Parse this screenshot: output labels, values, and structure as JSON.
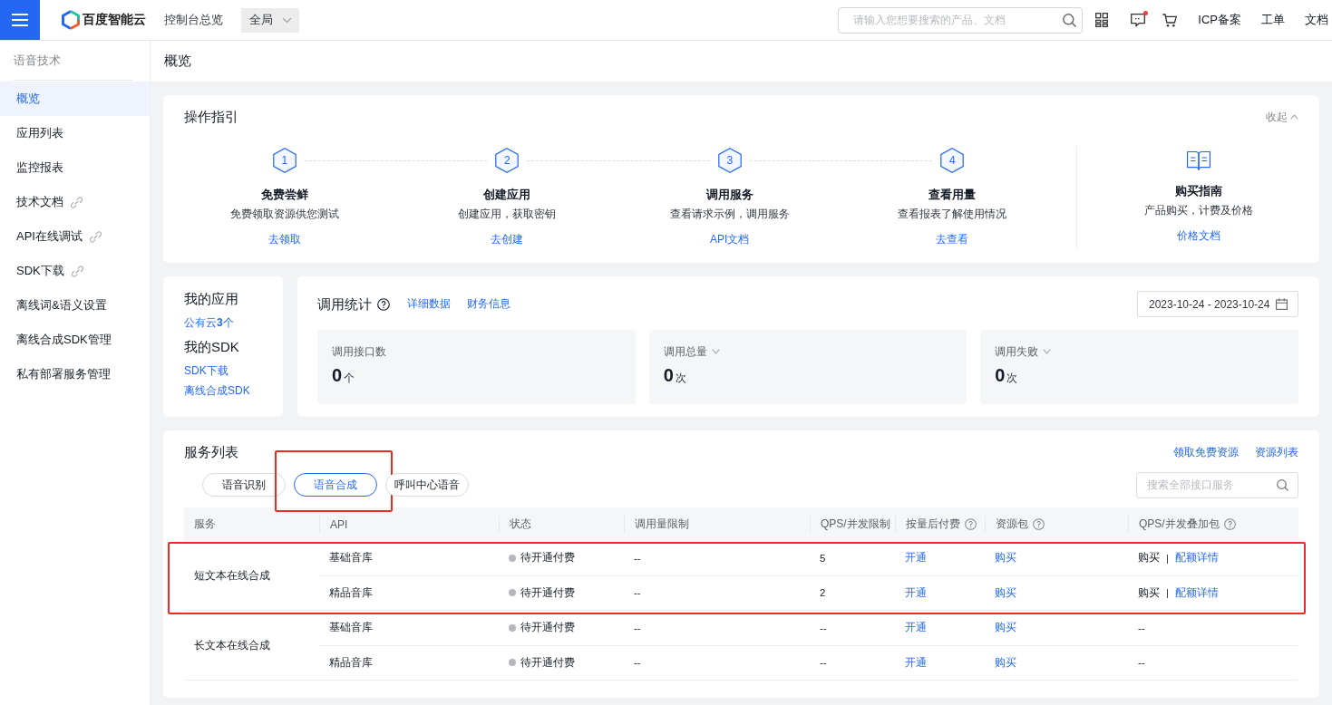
{
  "topbar": {
    "brand": "百度智能云",
    "console": "控制台总览",
    "region": "全局",
    "search": {
      "placeholder": "请输入您想要搜索的产品、文档"
    },
    "message_unread": true,
    "links": [
      "ICP备案",
      "工单",
      "文档"
    ]
  },
  "sidebar": {
    "title": "语音技术",
    "items": [
      {
        "label": "概览",
        "selected": true,
        "external": false
      },
      {
        "label": "应用列表",
        "selected": false,
        "external": false
      },
      {
        "label": "监控报表",
        "selected": false,
        "external": false
      },
      {
        "label": "技术文档",
        "selected": false,
        "external": true
      },
      {
        "label": "API在线调试",
        "selected": false,
        "external": true
      },
      {
        "label": "SDK下载",
        "selected": false,
        "external": true
      },
      {
        "label": "离线词&语义设置",
        "selected": false,
        "external": false
      },
      {
        "label": "离线合成SDK管理",
        "selected": false,
        "external": false
      },
      {
        "label": "私有部署服务管理",
        "selected": false,
        "external": false
      }
    ]
  },
  "page": {
    "title": "概览"
  },
  "guide": {
    "title": "操作指引",
    "collapse": "收起",
    "expanded": true,
    "steps": [
      {
        "number": "1",
        "title": "免费尝鲜",
        "description": "免费领取资源供您测试",
        "link": "去领取"
      },
      {
        "number": "2",
        "title": "创建应用",
        "description": "创建应用，获取密钥",
        "link": "去创建"
      },
      {
        "number": "3",
        "title": "调用服务",
        "description": "查看请求示例，调用服务",
        "link": "API文档"
      },
      {
        "number": "4",
        "title": "查看用量",
        "description": "查看报表了解使用情况",
        "link": "去查看"
      }
    ],
    "purchase": {
      "title": "购买指南",
      "description": "产品购买，计费及价格",
      "link": "价格文档"
    }
  },
  "my": {
    "apps": {
      "title": "我的应用",
      "link": "公有云**3**个"
    },
    "sdk": {
      "title": "我的SDK",
      "links": [
        "SDK下载",
        "离线合成SDK"
      ]
    }
  },
  "stats": {
    "title": "调用统计",
    "help": true,
    "links": [
      "详细数据",
      "财务信息"
    ],
    "date_range": "2023-10-24 - 2023-10-24",
    "tiles": [
      {
        "label": "调用接口数",
        "dropdown": false,
        "value": "0",
        "unit": "个"
      },
      {
        "label": "调用总量",
        "dropdown": true,
        "value": "0",
        "unit": "次"
      },
      {
        "label": "调用失败",
        "dropdown": true,
        "value": "0",
        "unit": "次"
      }
    ]
  },
  "services": {
    "title": "服务列表",
    "links": [
      "领取免费资源",
      "资源列表"
    ],
    "tabs": [
      {
        "label": "语音识别",
        "selected": false,
        "highlighted": false
      },
      {
        "label": "语音合成",
        "selected": true,
        "highlighted": true
      },
      {
        "label": "呼叫中心语音",
        "selected": false,
        "highlighted": false
      }
    ],
    "search": {
      "placeholder": "搜索全部接口服务"
    },
    "table": {
      "columns": [
        {
          "label": "服务",
          "help": false
        },
        {
          "label": "API",
          "help": false
        },
        {
          "label": "状态",
          "help": false
        },
        {
          "label": "调用量限制",
          "help": false
        },
        {
          "label": "QPS/并发限制",
          "help": false
        },
        {
          "label": "按量后付费",
          "help": true
        },
        {
          "label": "资源包",
          "help": true
        },
        {
          "label": "QPS/并发叠加包",
          "help": true
        }
      ],
      "groups": [
        {
          "service": "短文本在线合成",
          "highlighted": true,
          "rows": [
            {
              "api": "基础音库",
              "status": "待开通付费",
              "call_limit": "--",
              "qps_limit": "5",
              "postpaid": "开通",
              "package": "购买",
              "boost": [
                {
                  "kind": "text",
                  "text": "购买"
                },
                {
                  "kind": "separator",
                  "text": "|"
                },
                {
                  "kind": "link",
                  "text": "配额详情"
                }
              ]
            },
            {
              "api": "精品音库",
              "status": "待开通付费",
              "call_limit": "--",
              "qps_limit": "2",
              "postpaid": "开通",
              "package": "购买",
              "boost": [
                {
                  "kind": "text",
                  "text": "购买"
                },
                {
                  "kind": "separator",
                  "text": "|"
                },
                {
                  "kind": "link",
                  "text": "配额详情"
                }
              ]
            }
          ]
        },
        {
          "service": "长文本在线合成",
          "highlighted": false,
          "rows": [
            {
              "api": "基础音库",
              "status": "待开通付费",
              "call_limit": "--",
              "qps_limit": "--",
              "postpaid": "开通",
              "package": "购买",
              "boost": [
                {
                  "kind": "text",
                  "text": "--"
                }
              ]
            },
            {
              "api": "精品音库",
              "status": "待开通付费",
              "call_limit": "--",
              "qps_limit": "--",
              "postpaid": "开通",
              "package": "购买",
              "boost": [
                {
                  "kind": "text",
                  "text": "--"
                }
              ]
            }
          ]
        }
      ]
    }
  }
}
